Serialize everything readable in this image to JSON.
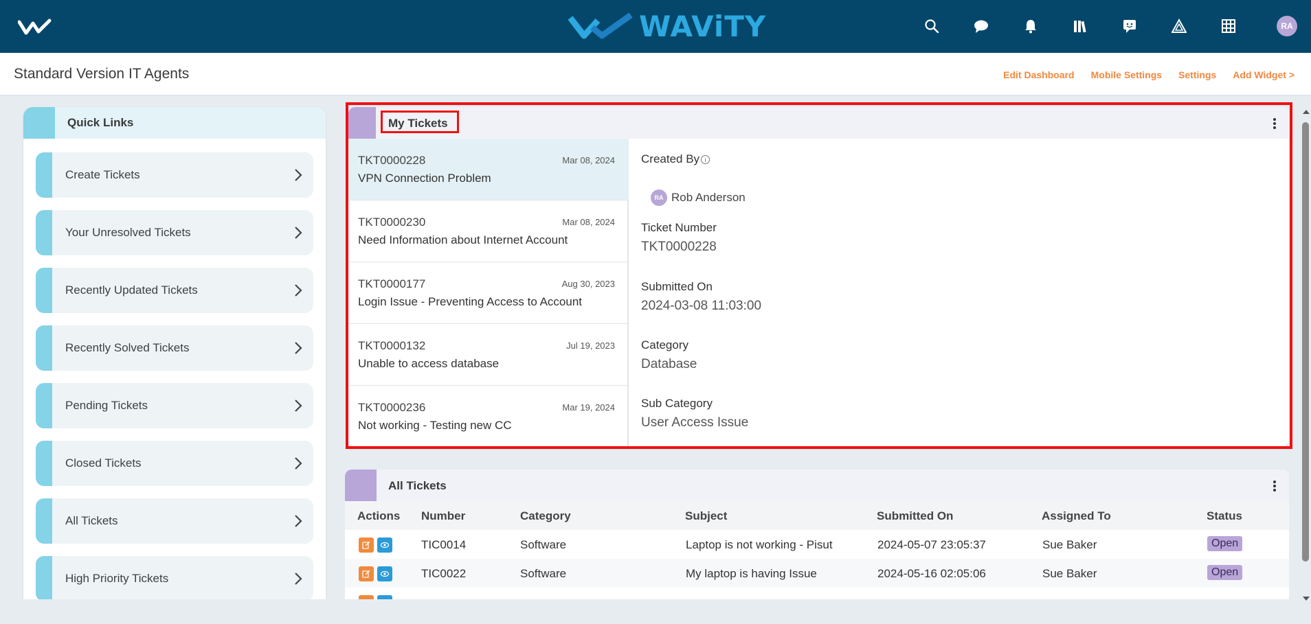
{
  "topbar": {
    "brand_text": "WAViTY",
    "avatar_initials": "RA",
    "icons": [
      "search-icon",
      "chat-icon",
      "bell-icon",
      "library-icon",
      "feedback-icon",
      "alert-icon",
      "apps-grid-icon"
    ]
  },
  "subheader": {
    "title": "Standard Version IT Agents",
    "links": [
      "Edit Dashboard",
      "Mobile Settings",
      "Settings",
      "Add Widget >"
    ]
  },
  "quick_links": {
    "title": "Quick Links",
    "items": [
      "Create Tickets",
      "Your Unresolved Tickets",
      "Recently Updated Tickets",
      "Recently Solved Tickets",
      "Pending Tickets",
      "Closed Tickets",
      "All Tickets",
      "High Priority Tickets"
    ]
  },
  "my_tickets": {
    "title": "My Tickets",
    "list": [
      {
        "number": "TKT0000228",
        "date": "Mar 08, 2024",
        "subject": "VPN Connection Problem"
      },
      {
        "number": "TKT0000230",
        "date": "Mar 08, 2024",
        "subject": "Need Information about Internet Account"
      },
      {
        "number": "TKT0000177",
        "date": "Aug 30, 2023",
        "subject": "Login Issue - Preventing Access to Account"
      },
      {
        "number": "TKT0000132",
        "date": "Jul 19, 2023",
        "subject": "Unable to access database"
      },
      {
        "number": "TKT0000236",
        "date": "Mar 19, 2024",
        "subject": "Not working - Testing new CC"
      }
    ],
    "detail": {
      "created_by_label": "Created By",
      "info_glyph": "i",
      "creator_initials": "RA",
      "creator_name": "Rob Anderson",
      "ticket_number_label": "Ticket Number",
      "ticket_number": "TKT0000228",
      "submitted_on_label": "Submitted On",
      "submitted_on": "2024-03-08 11:03:00",
      "category_label": "Category",
      "category": "Database",
      "sub_category_label": "Sub Category",
      "sub_category": "User Access Issue"
    }
  },
  "all_tickets": {
    "title": "All Tickets",
    "columns": [
      "Actions",
      "Number",
      "Category",
      "Subject",
      "Submitted On",
      "Assigned To",
      "Status"
    ],
    "rows": [
      {
        "number": "TIC0014",
        "category": "Software",
        "subject": "Laptop is not working - Pisut",
        "submitted_on": "2024-05-07 23:05:37",
        "assigned_to": "Sue Baker",
        "status": "Open"
      },
      {
        "number": "TIC0022",
        "category": "Software",
        "subject": "My laptop is having Issue",
        "submitted_on": "2024-05-16 02:05:06",
        "assigned_to": "Sue Baker",
        "status": "Open"
      }
    ]
  },
  "colors": {
    "topbar": "#04476a",
    "brand": "#2ca9e1",
    "link_orange": "#f0883e",
    "quick_accent": "#85d3e6",
    "widget_accent": "#b8a6d8",
    "highlight": "#ee1111"
  }
}
